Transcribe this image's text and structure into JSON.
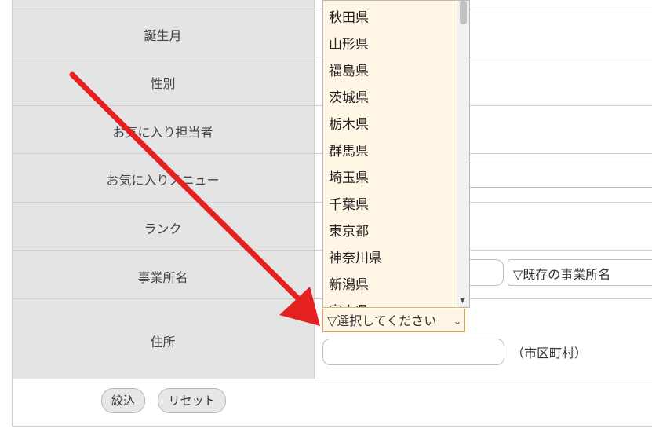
{
  "labels": {
    "birth_month": "誕生月",
    "gender": "性別",
    "favorite_staff": "お気に入り担当者",
    "favorite_menu": "お気に入りメニュー",
    "rank": "ランク",
    "office_name": "事業所名",
    "address": "住所"
  },
  "office": {
    "existing_select": "▽既存の事業所名"
  },
  "address": {
    "prefecture_select": "▽選択してください",
    "city_suffix": "（市区町村）"
  },
  "dropdown": {
    "options": [
      "秋田県",
      "山形県",
      "福島県",
      "茨城県",
      "栃木県",
      "群馬県",
      "埼玉県",
      "千葉県",
      "東京都",
      "神奈川県",
      "新潟県",
      "富山県"
    ]
  },
  "buttons": {
    "filter": "絞込",
    "reset": "リセット"
  },
  "colors": {
    "arrow": "#e52020",
    "dropdown_bg": "#fff6e6",
    "select_border": "#e0a248",
    "label_bg": "#e4e4e4"
  },
  "icons": {
    "chevron": "chevron-down-icon",
    "arrow": "red-arrow-annotation"
  }
}
